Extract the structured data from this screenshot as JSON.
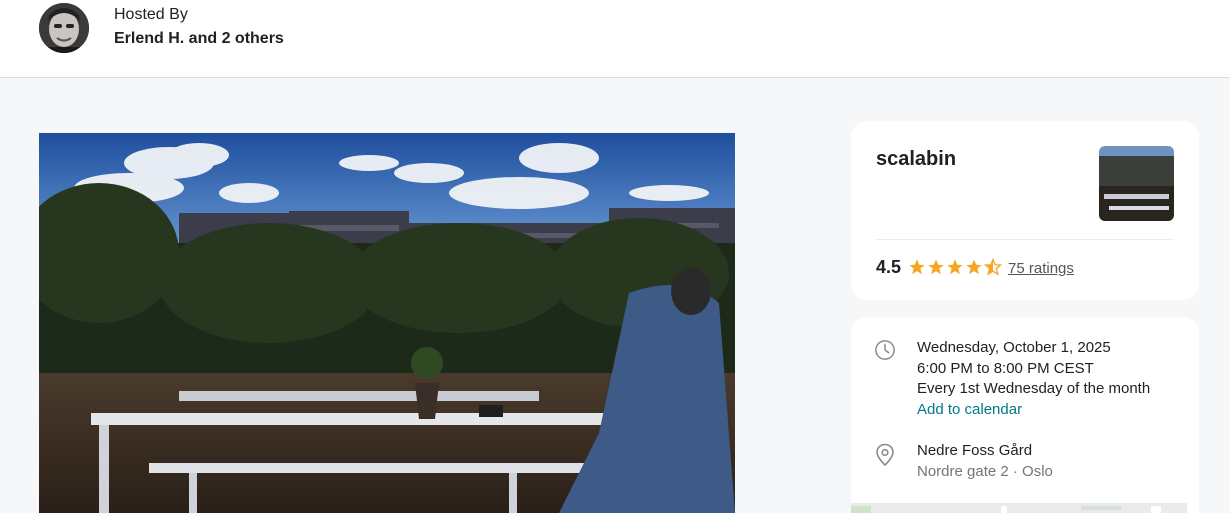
{
  "host": {
    "label": "Hosted By",
    "names": "Erlend H. and 2 others"
  },
  "group": {
    "name": "scalabin",
    "rating": "4.5",
    "ratings_link": "75 ratings",
    "stars": 4.5
  },
  "event": {
    "date": "Wednesday, October 1, 2025",
    "time": "6:00 PM to 8:00 PM CEST",
    "recurrence": "Every 1st Wednesday of the month",
    "add_to_calendar": "Add to calendar",
    "venue": "Nedre Foss Gård",
    "address": "Nordre gate 2 · Oslo"
  },
  "colors": {
    "accent": "#00798a",
    "star": "#f5a623",
    "page_bg": "#f6f7f8"
  },
  "icons": [
    "clock-icon",
    "map-pin-icon",
    "star-icon"
  ]
}
